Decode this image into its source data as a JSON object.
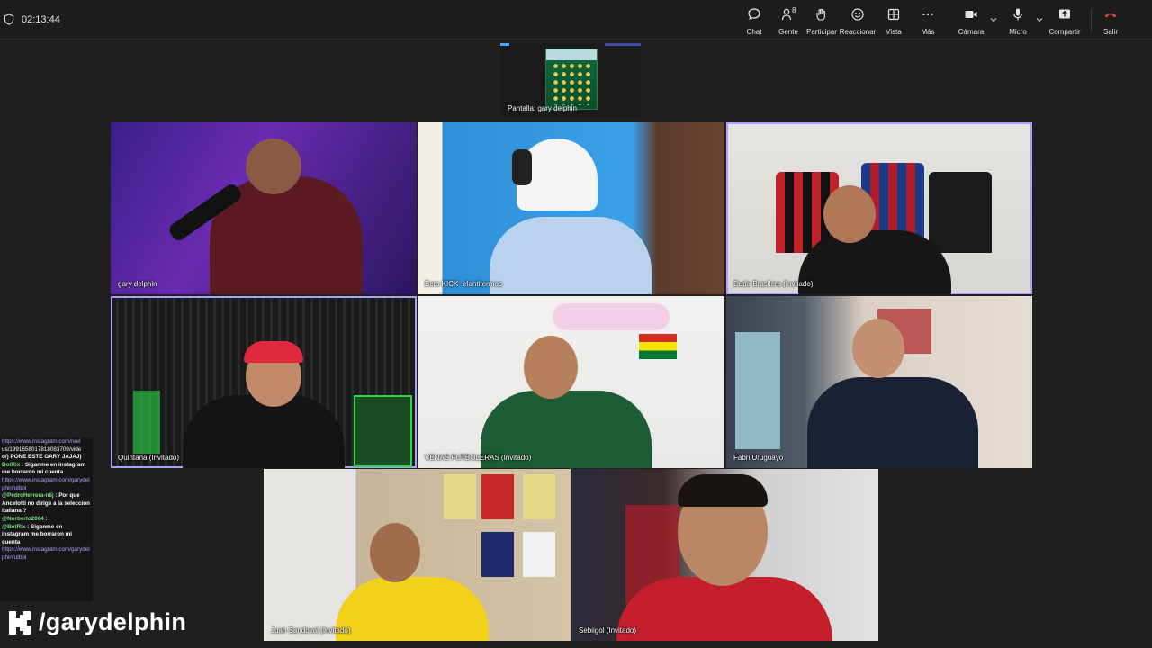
{
  "toolbar": {
    "timer": "02:13:44",
    "buttons": {
      "chat": "Chat",
      "people": "Gente",
      "people_count": "8",
      "raise": "Participar",
      "react": "Reaccionar",
      "view": "Vista",
      "more": "Más",
      "camera": "Cámara",
      "mic": "Micro",
      "share": "Compartir",
      "leave": "Salir"
    }
  },
  "screen_share": {
    "label": "Pantalla: gary delphin"
  },
  "participants": [
    {
      "name": "gary delphin"
    },
    {
      "name": "Beto KICK- elantitermos"
    },
    {
      "name": "Duda Brasilero (Invitado)"
    },
    {
      "name": "Quintana (Invitado)"
    },
    {
      "name": "VENAS FUTBOLERAS (Invitado)"
    },
    {
      "name": "Fabri Uruguayo"
    },
    {
      "name": "Juan Sandoval (Invitado)"
    },
    {
      "name": "Sebiigol (Invitado)"
    }
  ],
  "colors": {
    "accent_border": "#a7a3ff",
    "leave_red": "#e14b4b",
    "kick_green": "#53fc18"
  },
  "chat_overlay": {
    "messages": [
      {
        "text": "https://www.instagram.com/reel"
      },
      {
        "text": "us/1991658017818083709/vide"
      },
      {
        "text": "o/) PONE ESTE GARY JAJAJ)"
      },
      {
        "user": "BotRix",
        "text": " : Siganme en instagram me borraron mi cuenta"
      },
      {
        "link": "https://www.instagram.com/garydelphinfutbol"
      },
      {
        "user": "@PedroHerrera-n6j",
        "text": " : Por que Ancelotti no dirige a la selección italiana.?"
      },
      {
        "user": "@Norberto2004",
        "text": " :"
      },
      {
        "user": "@BotRix",
        "text": " : Siganme en instagram me borraron mi cuenta"
      },
      {
        "link": "https://www.instagram.com/garydelphinfutbol"
      }
    ]
  },
  "kick_overlay": {
    "handle": "/garydelphin"
  }
}
